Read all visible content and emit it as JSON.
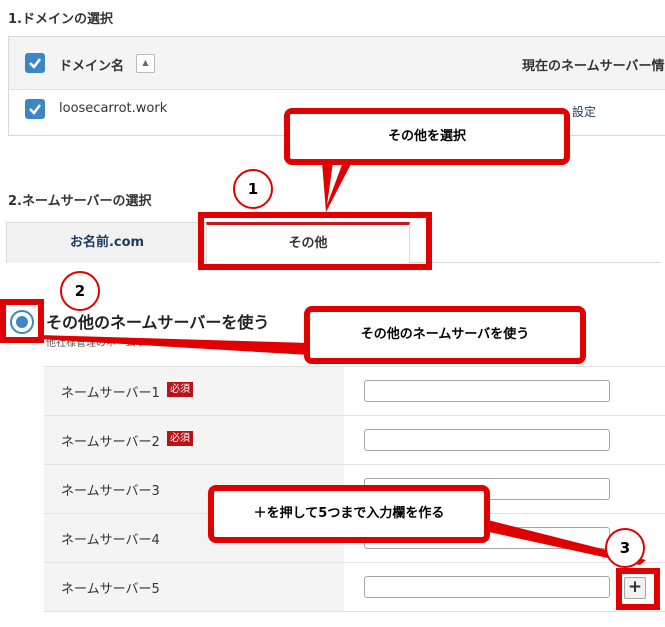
{
  "section1": {
    "title": "1.ドメインの選択"
  },
  "domain_table": {
    "header_domain": "ドメイン名",
    "header_sort": "▲",
    "header_nameserver": "現在のネームサーバー情",
    "row_domain": "loosecarrot.work",
    "row_status": "設定"
  },
  "section2": {
    "title": "2.ネームサーバーの選択"
  },
  "tabs": [
    {
      "label": "お名前.com"
    },
    {
      "label": "その他"
    }
  ],
  "radio": {
    "label": "その他のネームサーバーを使う",
    "sublabel": "他社様管理のネームサ"
  },
  "nameservers": [
    {
      "label": "ネームサーバー1",
      "required": "必須"
    },
    {
      "label": "ネームサーバー2",
      "required": "必須"
    },
    {
      "label": "ネームサーバー3"
    },
    {
      "label": "ネームサーバー4"
    },
    {
      "label": "ネームサーバー5"
    }
  ],
  "add_button": {
    "label": "+"
  },
  "annotations": {
    "callout1": "その他を選択",
    "callout2": "その他のネームサーバを使う",
    "callout3": "＋を押して5つまで入力欄を作る",
    "num1": "1",
    "num2": "2",
    "num3": "3"
  },
  "colors": {
    "accent_red": "#e00000",
    "checkbox_blue": "#3d86c6",
    "required_red": "#b7141a"
  }
}
